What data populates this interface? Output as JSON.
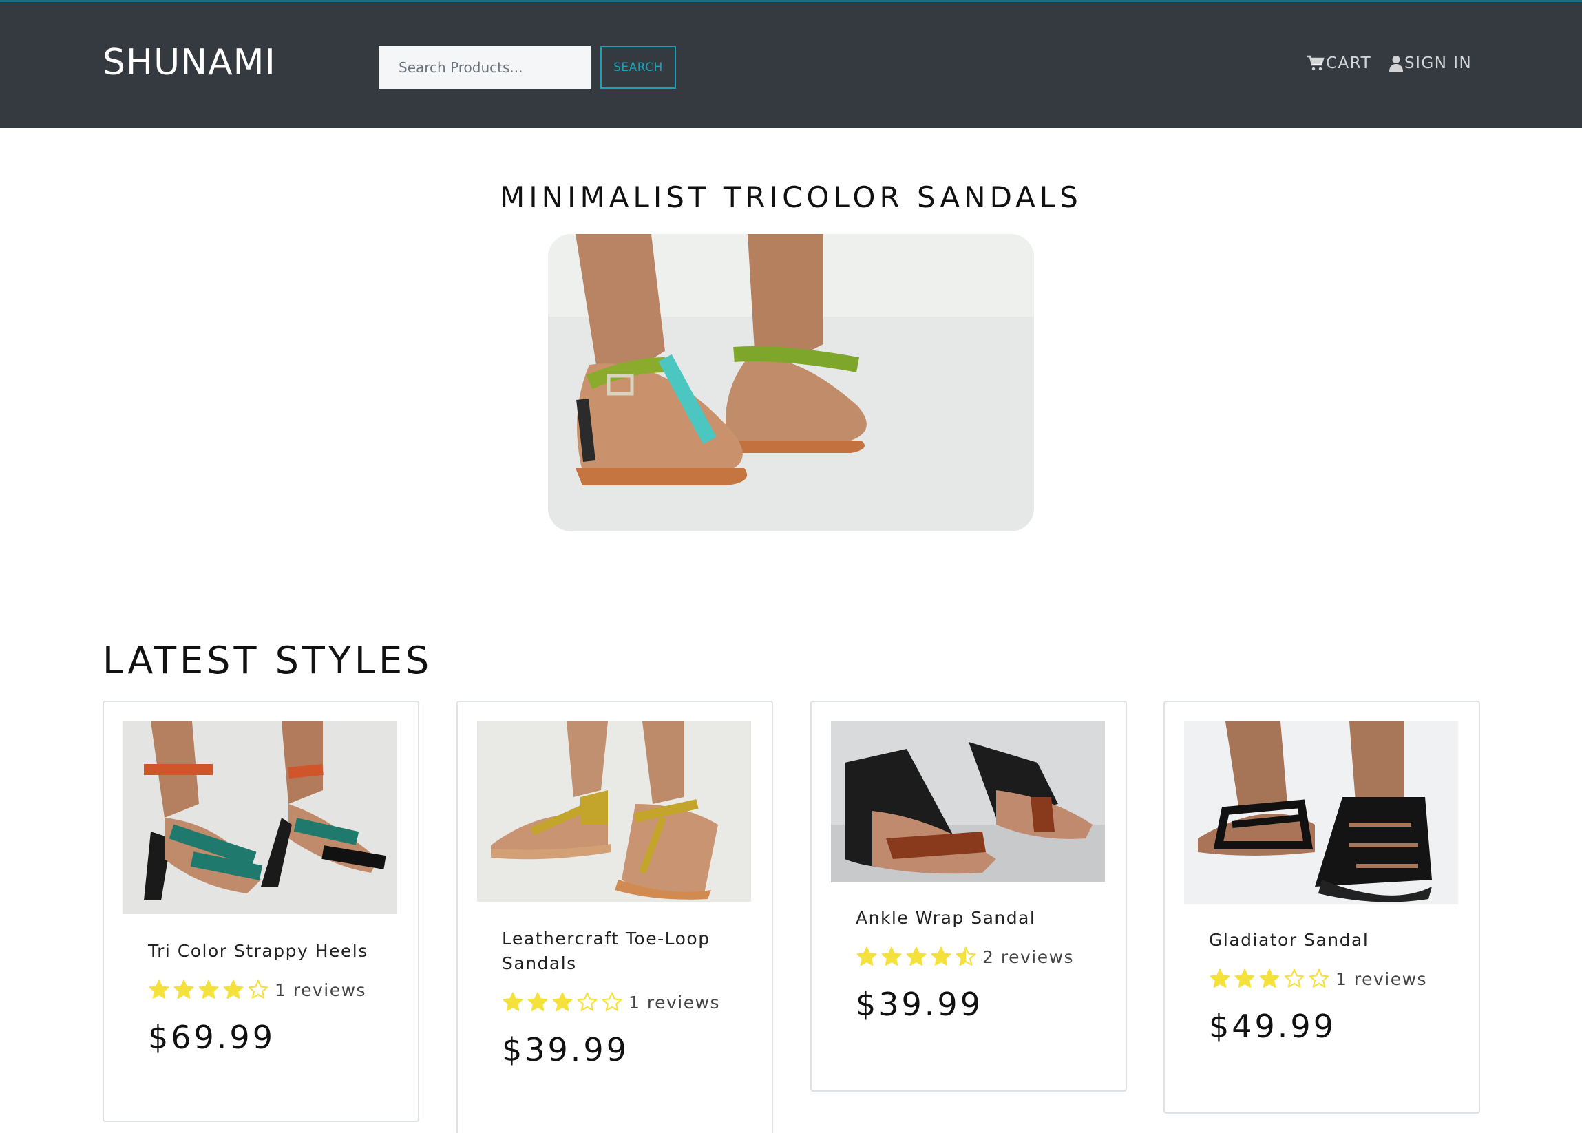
{
  "header": {
    "brand": "SHUNAMI",
    "search_placeholder": "Search Products...",
    "search_button": "SEARCH",
    "cart_label": "CART",
    "signin_label": "SIGN IN",
    "cart_icon": "shopping-cart-icon",
    "signin_icon": "user-icon"
  },
  "hero": {
    "title": "MINIMALIST TRICOLOR SANDALS"
  },
  "latest": {
    "title": "LATEST STYLES",
    "products": [
      {
        "name": "Tri Color Strappy Heels",
        "rating": 4,
        "reviews": "1 reviews",
        "price": "$69.99"
      },
      {
        "name": "Leathercraft Toe-Loop Sandals",
        "rating": 3,
        "reviews": "1 reviews",
        "price": "$39.99"
      },
      {
        "name": "Ankle Wrap Sandal",
        "rating": 4.5,
        "reviews": "2 reviews",
        "price": "$39.99"
      },
      {
        "name": "Gladiator Sandal",
        "rating": 3,
        "reviews": "1 reviews",
        "price": "$49.99"
      }
    ]
  },
  "colors": {
    "navbar": "#343a40",
    "accent": "#17a2b8",
    "star": "#f5e13b"
  }
}
